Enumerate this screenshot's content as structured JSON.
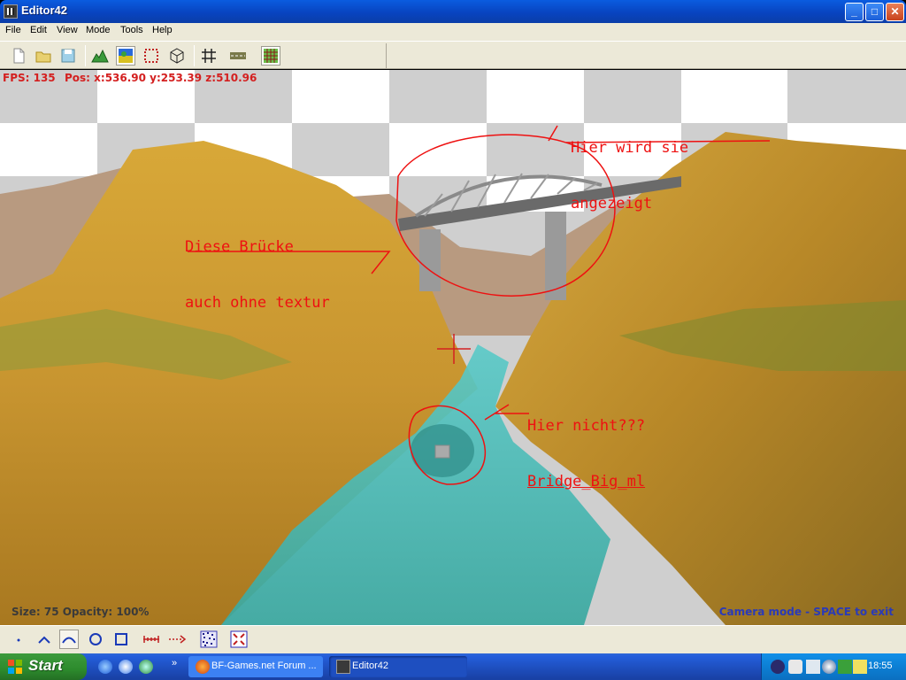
{
  "window": {
    "title": "Editor42",
    "minimize": "_",
    "maximize": "□",
    "close": "✕"
  },
  "menu": [
    "File",
    "Edit",
    "View",
    "Mode",
    "Tools",
    "Help"
  ],
  "toolbar": [
    "new-file-icon",
    "open-folder-icon",
    "save-disk-icon",
    "terrain-mountain-icon",
    "texture-paint-icon",
    "selection-region-icon",
    "object-cube-icon",
    "grid-icon",
    "road-icon",
    "tile-grid-icon"
  ],
  "hud": {
    "fps": "FPS: 135",
    "pos": "Pos: x:536.90  y:253.39  z:510.96",
    "brush": "Size: 75   Opacity: 100%",
    "camera_hint": "Camera mode - SPACE to exit"
  },
  "annotations": {
    "shown_line1": "Hier wird sie",
    "shown_line2": "angezeigt",
    "bridge_line1": "Diese Brücke",
    "bridge_line2": "auch ohne textur",
    "notshown_line1": "Hier nicht???",
    "notshown_line2": "Bridge_Big_ml",
    "color": "#ee1111"
  },
  "bottom_tools": [
    "point-tool-icon",
    "peak-tool-icon",
    "smooth-curve-tool-icon",
    "circle-tool-icon",
    "square-tool-icon",
    "measure-distance-icon",
    "dotted-line-arrow-icon",
    "noise-pattern-icon",
    "fit-view-icon"
  ],
  "taskbar": {
    "start": "Start",
    "tasks": [
      "BF-Games.net Forum ...",
      "Editor42"
    ],
    "clock": "18:55"
  },
  "colors": {
    "title_blue": "#0a5ce0",
    "start_green": "#3c9a3c",
    "water": "#4ab8b0",
    "terrain": "#c89a30"
  }
}
